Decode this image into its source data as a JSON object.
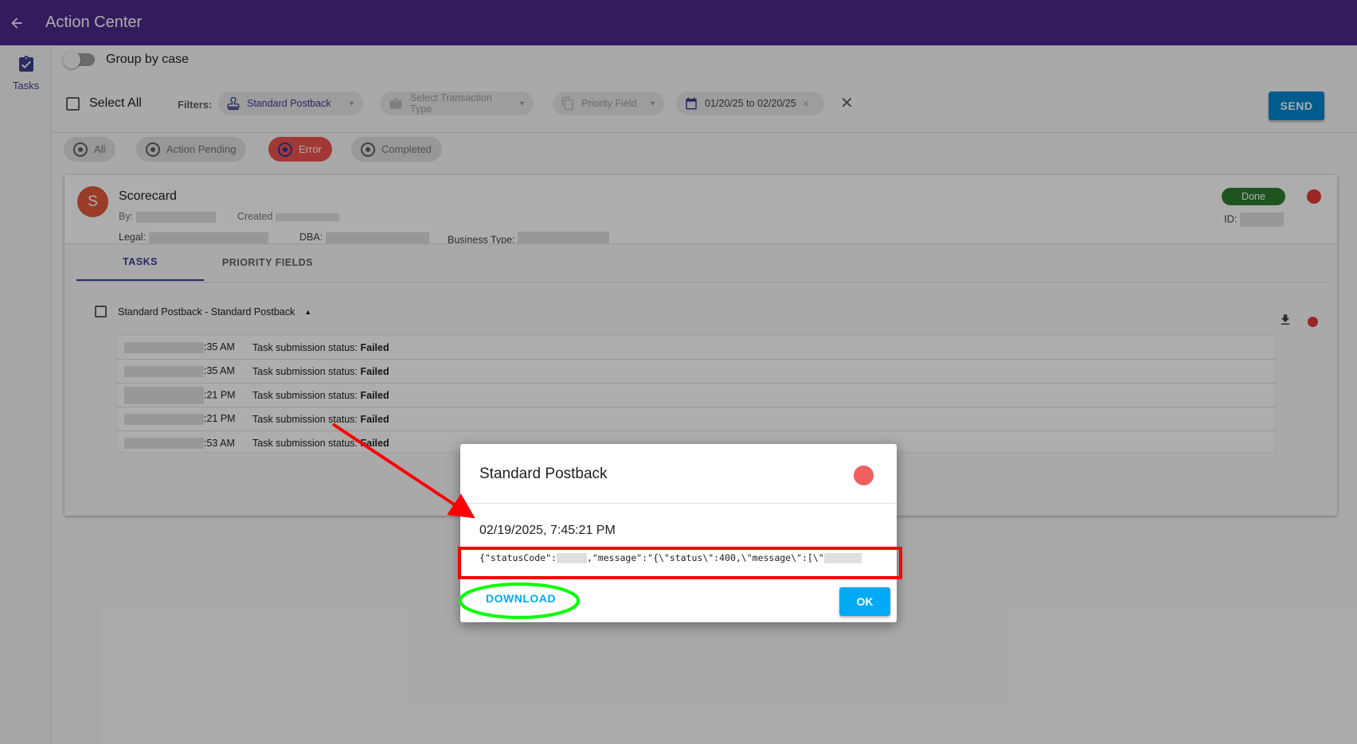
{
  "appbar": {
    "title": "Action Center"
  },
  "sidebar": {
    "items": [
      {
        "label": "Tasks"
      }
    ]
  },
  "toolbar": {
    "group_by_case": "Group by case",
    "select_all": "Select All",
    "filters_label": "Filters:",
    "filter_postback": "Standard Postback",
    "filter_transaction_placeholder": "Select Transaction Type",
    "filter_priority_placeholder": "Priority Field",
    "date_range": "01/20/25 to 02/20/25",
    "send_label": "SEND"
  },
  "status_filters": [
    {
      "label": "All"
    },
    {
      "label": "Action Pending"
    },
    {
      "label": "Error"
    },
    {
      "label": "Completed"
    }
  ],
  "case": {
    "avatar_letter": "S",
    "title": "Scorecard",
    "by_label": "By:",
    "created_label": "Created",
    "legal_label": "Legal:",
    "dba_label": "DBA:",
    "business_type_label": "Business Type:",
    "status_badge": "Done",
    "id_label": "ID:",
    "tabs": [
      {
        "label": "TASKS"
      },
      {
        "label": "PRIORITY FIELDS"
      }
    ],
    "task_name": "Standard Postback - Standard Postback",
    "logs": [
      {
        "time": ":35 AM",
        "message": "Task submission status:",
        "status": "Failed"
      },
      {
        "time": ":35 AM",
        "message": "Task submission status:",
        "status": "Failed"
      },
      {
        "time": ":21 PM",
        "message": "Task submission status:",
        "status": "Failed"
      },
      {
        "time": ":21 PM",
        "message": "Task submission status:",
        "status": "Failed"
      },
      {
        "time": ":53 AM",
        "message": "Task submission status:",
        "status": "Failed"
      }
    ]
  },
  "dialog": {
    "title": "Standard Postback",
    "timestamp": "02/19/2025, 7:45:21 PM",
    "json_part1": "{\"statusCode\":",
    "json_part2": ",\"message\":\"{\\\"status\\\":400,\\\"message\\\":[\\\"",
    "download_label": "DOWNLOAD",
    "ok_label": "OK"
  },
  "colors": {
    "appbar": "#4a2a8a",
    "accent": "#03a9f4",
    "error": "#ef5350",
    "done": "#2e7d32",
    "annotation_red": "#ff0000",
    "annotation_green": "#00ff00"
  }
}
